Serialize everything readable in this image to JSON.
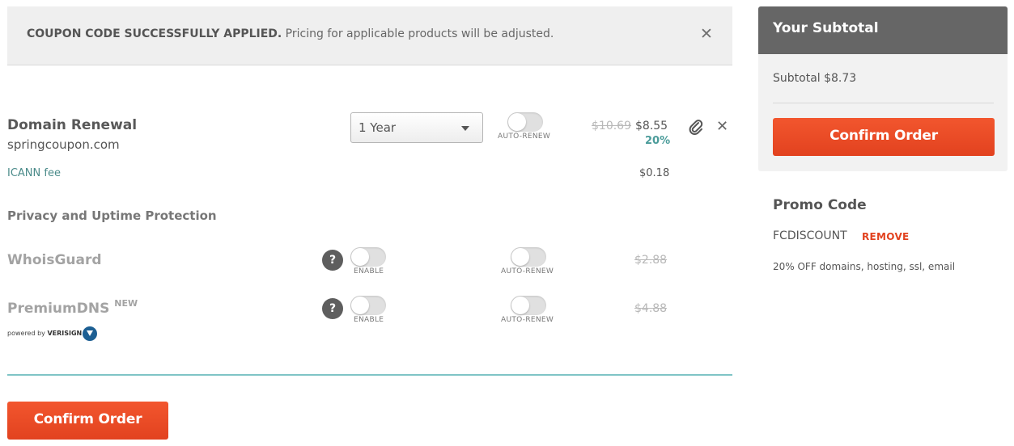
{
  "banner": {
    "bold_text": "COUPON CODE SUCCESSFULLY APPLIED.",
    "text": " Pricing for applicable products will be adjusted.",
    "close_glyph": "✕"
  },
  "product": {
    "title": "Domain Renewal",
    "domain": "springcoupon.com",
    "term_selected": "1 Year",
    "auto_renew_label": "AUTO-RENEW",
    "old_price": "$10.69",
    "new_price": "$8.55",
    "discount": "20%",
    "icann_label": "ICANN fee",
    "icann_price": "$0.18",
    "icons": [
      "paperclip-icon",
      "close-icon"
    ]
  },
  "privacy": {
    "title": "Privacy and Uptime Protection",
    "addons": [
      {
        "name": "WhoisGuard",
        "badge": "",
        "enable_label": "ENABLE",
        "auto_renew_label": "AUTO-RENEW",
        "price": "$2.88"
      },
      {
        "name": "PremiumDNS",
        "badge": "NEW",
        "enable_label": "ENABLE",
        "auto_renew_label": "AUTO-RENEW",
        "price": "$4.88"
      }
    ],
    "powered_by": "powered by",
    "powered_brand": "VERISIGN"
  },
  "actions": {
    "confirm_label": "Confirm Order"
  },
  "summary": {
    "header": "Your Subtotal",
    "subtotal": "Subtotal $8.73",
    "confirm_label": "Confirm Order"
  },
  "promo": {
    "title": "Promo Code",
    "code": "FCDISCOUNT",
    "remove_label": "REMOVE",
    "description": "20% OFF domains, hosting, ssl, email"
  },
  "colors": {
    "accent": "#e9482a",
    "teal": "#4b9c9a",
    "header_bg": "#666666"
  }
}
